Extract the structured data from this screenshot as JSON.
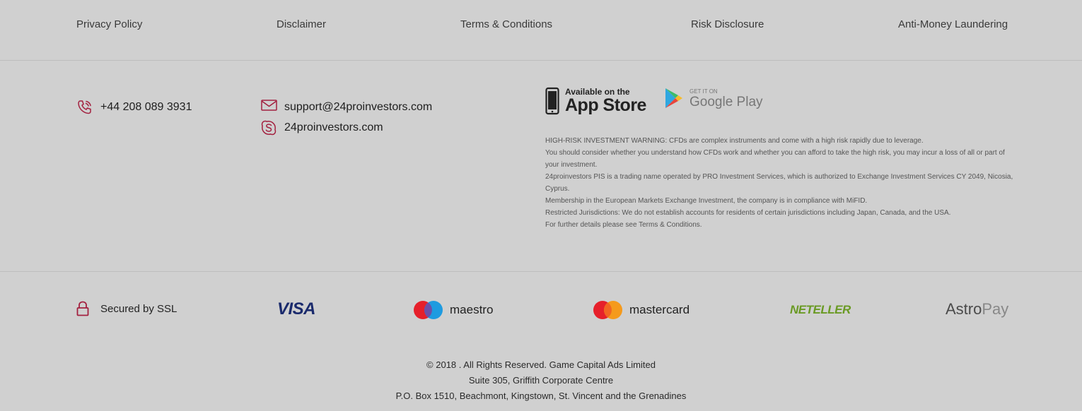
{
  "footer_links": [
    "Privacy Policy",
    "Disclaimer",
    "Terms & Conditions",
    "Risk Disclosure",
    "Anti-Money Laundering"
  ],
  "contact": {
    "phone": "+44 208 089 3931",
    "email": "support@24proinvestors.com",
    "skype": "24proinvestors.com"
  },
  "icons": {
    "phone": "phone-icon",
    "email": "mail-icon",
    "skype": "skype-icon",
    "ssl": "lock-icon"
  },
  "stores": {
    "appstore_small": "Available on the",
    "appstore_big": "App Store",
    "googleplay_small": "GET IT ON",
    "googleplay_big": "Google Play"
  },
  "warning": [
    "HIGH-RISK INVESTMENT WARNING: CFDs are complex instruments and come with a high risk rapidly due to leverage.",
    "You should consider whether you understand how CFDs work and whether you can afford to take the high risk, you may incur a loss of all or part of your investment.",
    "24proinvestors PIS is a trading name operated by PRO Investment Services, which is authorized to Exchange Investment Services CY 2049, Nicosia, Cyprus.",
    "Membership in the European Markets Exchange Investment, the company is in compliance with MiFID.",
    "Restricted Jurisdictions: We do not establish accounts for residents of certain jurisdictions including Japan, Canada, and the USA.",
    "For further details please see Terms & Conditions."
  ],
  "payments": {
    "ssl": "Secured by SSL",
    "visa": "VISA",
    "maestro": "maestro",
    "mastercard": "mastercard",
    "neteller": "NETELLER",
    "astro_a": "Astro",
    "astro_b": "Pay"
  },
  "copyright": [
    "© 2018 . All Rights Reserved. Game Capital Ads Limited",
    "Suite 305, Griffith Corporate Centre",
    "P.O. Box 1510, Beachmont, Kingstown, St. Vincent and the Grenadines"
  ],
  "colors": {
    "background": "#d0d0d0",
    "accent": "#a3203f",
    "visa": "#1a2a6c",
    "neteller": "#6a9a24"
  }
}
